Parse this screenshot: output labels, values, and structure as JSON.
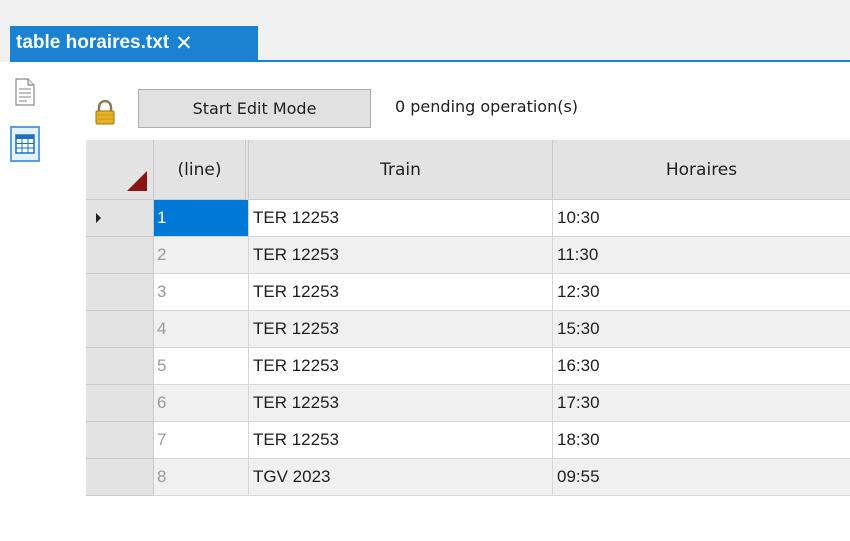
{
  "tab": {
    "title": "table horaires.txt",
    "close_glyph": "✕",
    "accent": "#1b82d2"
  },
  "sidebar": {
    "views": [
      {
        "icon": "text-document-icon"
      },
      {
        "icon": "table-grid-icon",
        "selected": true
      }
    ]
  },
  "toolbar": {
    "lock_icon": "lock-icon",
    "edit_button_label": "Start Edit Mode",
    "pending_text": "0 pending operation(s)"
  },
  "grid": {
    "columns": [
      "(line)",
      "Train",
      "Horaires"
    ],
    "selected_row": 0,
    "rows": [
      {
        "line": "1",
        "train": "TER 12253",
        "horaires": "10:30"
      },
      {
        "line": "2",
        "train": "TER 12253",
        "horaires": "11:30"
      },
      {
        "line": "3",
        "train": "TER 12253",
        "horaires": "12:30"
      },
      {
        "line": "4",
        "train": "TER 12253",
        "horaires": "15:30"
      },
      {
        "line": "5",
        "train": "TER 12253",
        "horaires": "16:30"
      },
      {
        "line": "6",
        "train": "TER 12253",
        "horaires": "17:30"
      },
      {
        "line": "7",
        "train": "TER 12253",
        "horaires": "18:30"
      },
      {
        "line": "8",
        "train": "TGV 2023",
        "horaires": "09:55"
      }
    ]
  }
}
